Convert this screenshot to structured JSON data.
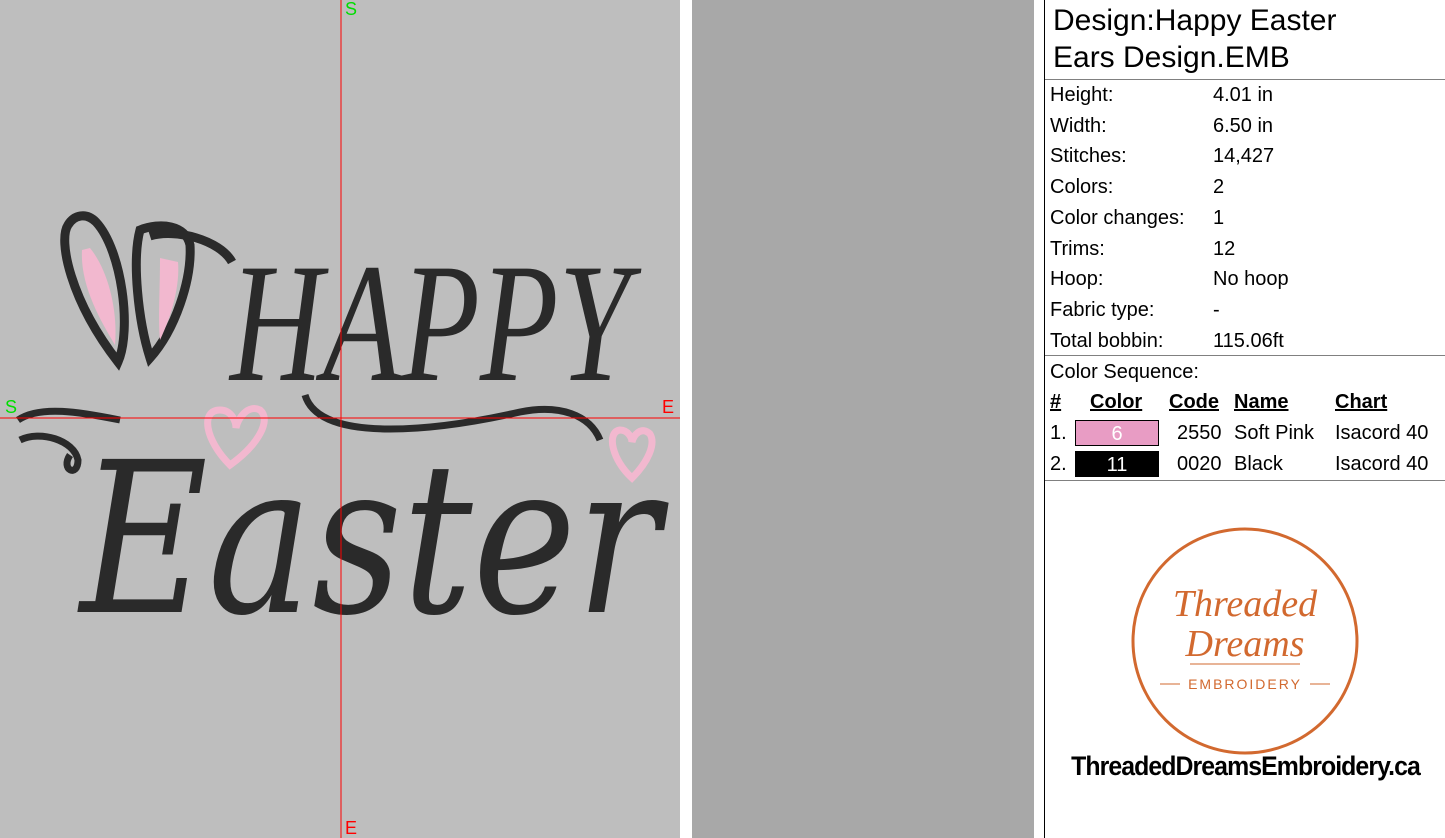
{
  "design": {
    "title_line1": "Design:Happy Easter",
    "title_line2": "Ears Design.EMB"
  },
  "canvas": {
    "axis_top": "S",
    "axis_left": "S",
    "axis_right": "E",
    "axis_bottom": "E",
    "artwork": {
      "word1": "HAPPY",
      "word2": "Easter"
    },
    "colors": {
      "background": "#bebebe",
      "crosshair": "#ff0000",
      "start_label": "#00dd00",
      "thread_black": "#2a2a2a",
      "thread_pink": "#f2b8cf"
    }
  },
  "properties": [
    {
      "label": "Height:",
      "value": "4.01 in"
    },
    {
      "label": "Width:",
      "value": "6.50 in"
    },
    {
      "label": "Stitches:",
      "value": "14,427"
    },
    {
      "label": "Colors:",
      "value": "2"
    },
    {
      "label": "Color changes:",
      "value": "1"
    },
    {
      "label": "Trims:",
      "value": "12"
    },
    {
      "label": "Hoop:",
      "value": "No hoop"
    },
    {
      "label": "Fabric type:",
      "value": "-"
    },
    {
      "label": "Total bobbin:",
      "value": "115.06ft"
    }
  ],
  "color_sequence": {
    "label": "Color Sequence:",
    "headers": {
      "num": "#",
      "color": "Color",
      "code": "Code",
      "name": "Name",
      "chart": "Chart"
    },
    "rows": [
      {
        "num": "1.",
        "swatch": "6",
        "swatch_color": "#e89cc4",
        "swatch_text_color": "#ffffff",
        "code": "2550",
        "name": "Soft Pink",
        "chart": "Isacord 40"
      },
      {
        "num": "2.",
        "swatch": "11",
        "swatch_color": "#000000",
        "swatch_text_color": "#ffffff",
        "code": "0020",
        "name": "Black",
        "chart": "Isacord 40"
      }
    ]
  },
  "logo": {
    "line1": "Threaded",
    "line2": "Dreams",
    "line3": "EMBROIDERY",
    "color": "#d2692f"
  },
  "website": "ThreadedDreamsEmbroidery.ca"
}
